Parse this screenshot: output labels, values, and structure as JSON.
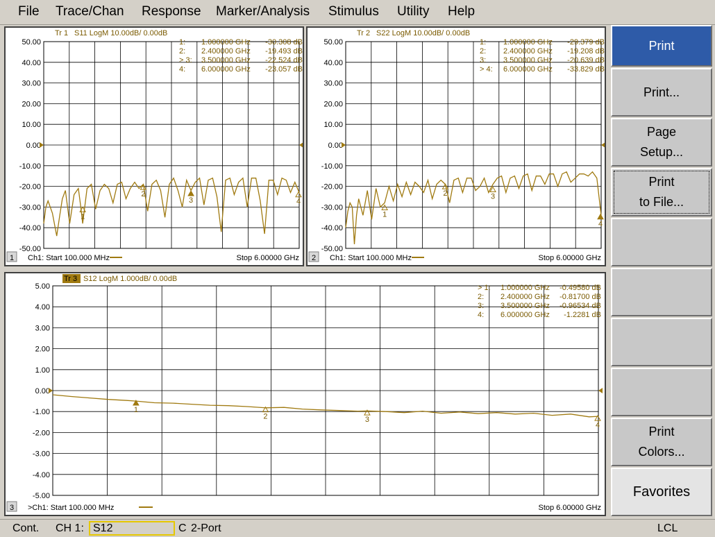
{
  "menu": [
    "File",
    "Trace/Chan",
    "Response",
    "Marker/Analysis",
    "Stimulus",
    "Utility",
    "Help"
  ],
  "softkeys": [
    {
      "lines": [
        "Print"
      ],
      "active": true
    },
    {
      "lines": [
        "Print..."
      ]
    },
    {
      "lines": [
        "Page",
        "Setup..."
      ]
    },
    {
      "lines": [
        "Print",
        "to File..."
      ],
      "focused": true
    },
    {
      "lines": [
        ""
      ]
    },
    {
      "lines": [
        ""
      ]
    },
    {
      "lines": [
        ""
      ]
    },
    {
      "lines": [
        ""
      ]
    },
    {
      "lines": [
        "Print",
        "Colors..."
      ]
    },
    {
      "lines": [
        "Favorites"
      ],
      "favorites": true
    }
  ],
  "status": {
    "mode": "Cont.",
    "channel": "CH 1:",
    "parameter": "S12",
    "cal": "C",
    "port": "2-Port",
    "remote": "LCL"
  },
  "colors": {
    "trace": "#a07a10",
    "grid": "#000000",
    "text": "#7a5a00",
    "active_bg": "#2e5ba8"
  },
  "chart_data": [
    {
      "type": "line",
      "window_number": "1",
      "trace_id": "Tr 1",
      "title": "S11 LogM 10.00dB/ 0.00dB",
      "ylim": [
        -50,
        50
      ],
      "yticks": [
        50,
        40,
        30,
        20,
        10,
        0,
        -10,
        -20,
        -30,
        -40,
        -50
      ],
      "ytick_labels": [
        "50.00",
        "40.00",
        "30.00",
        "20.00",
        "10.00",
        "0.00",
        "-10.00",
        "-20.00",
        "-30.00",
        "-40.00",
        "-50.00"
      ],
      "xlim": [
        0.1,
        6.0
      ],
      "start_label": "Ch1: Start  100.000 MHz",
      "stop_label": "Stop  6.00000 GHz",
      "reference_level": 0,
      "markers": [
        {
          "id": "1",
          "active": false,
          "freq": "1.000000 GHz",
          "value": "-30.308 dB",
          "x": 1.0,
          "y": -30.308
        },
        {
          "id": "2",
          "active": false,
          "freq": "2.400000 GHz",
          "value": "-19.493 dB",
          "x": 2.4,
          "y": -19.493
        },
        {
          "id": "3",
          "active": true,
          "freq": "3.500000 GHz",
          "value": "-22.524 dB",
          "x": 3.5,
          "y": -22.524
        },
        {
          "id": "4",
          "active": false,
          "freq": "6.000000 GHz",
          "value": "-23.057 dB",
          "x": 6.0,
          "y": -23.057
        }
      ],
      "series": [
        {
          "x": [
            0.1,
            0.15,
            0.2,
            0.3,
            0.4,
            0.47,
            0.53,
            0.6,
            0.7,
            0.8,
            0.9,
            0.95,
            1.0,
            1.1,
            1.2,
            1.3,
            1.4,
            1.5,
            1.6,
            1.7,
            1.8,
            1.9,
            2.0,
            2.1,
            2.2,
            2.3,
            2.4,
            2.5,
            2.6,
            2.7,
            2.8,
            2.9,
            3.0,
            3.1,
            3.2,
            3.3,
            3.4,
            3.5,
            3.6,
            3.7,
            3.8,
            3.9,
            4.0,
            4.1,
            4.2,
            4.3,
            4.4,
            4.5,
            4.6,
            4.7,
            4.8,
            4.9,
            5.0,
            5.1,
            5.2,
            5.3,
            5.4,
            5.5,
            5.6,
            5.7,
            5.8,
            5.9,
            6.0
          ],
          "y": [
            -38,
            -30,
            -27,
            -33,
            -44,
            -34,
            -26,
            -22,
            -38,
            -24,
            -21,
            -29,
            -38,
            -21,
            -19,
            -31,
            -22,
            -19,
            -21,
            -28,
            -19,
            -18,
            -26,
            -21,
            -18,
            -21,
            -19,
            -32,
            -19,
            -17,
            -22,
            -35,
            -19,
            -16,
            -22,
            -30,
            -17,
            -22,
            -18,
            -16,
            -29,
            -17,
            -16,
            -25,
            -42,
            -17,
            -16,
            -24,
            -18,
            -16,
            -30,
            -16,
            -16,
            -27,
            -43,
            -17,
            -17,
            -24,
            -16,
            -17,
            -23,
            -18,
            -23
          ]
        }
      ]
    },
    {
      "type": "line",
      "window_number": "2",
      "trace_id": "Tr 2",
      "title": "S22 LogM 10.00dB/ 0.00dB",
      "ylim": [
        -50,
        50
      ],
      "yticks": [
        50,
        40,
        30,
        20,
        10,
        0,
        -10,
        -20,
        -30,
        -40,
        -50
      ],
      "ytick_labels": [
        "50.00",
        "40.00",
        "30.00",
        "20.00",
        "10.00",
        "0.00",
        "-10.00",
        "-20.00",
        "-30.00",
        "-40.00",
        "-50.00"
      ],
      "xlim": [
        0.1,
        6.0
      ],
      "start_label": "Ch1: Start  100.000 MHz",
      "stop_label": "Stop  6.00000 GHz",
      "reference_level": 0,
      "markers": [
        {
          "id": "1",
          "active": false,
          "freq": "1.000000 GHz",
          "value": "-29.379 dB",
          "x": 1.0,
          "y": -29.379
        },
        {
          "id": "2",
          "active": false,
          "freq": "2.400000 GHz",
          "value": "-19.208 dB",
          "x": 2.4,
          "y": -19.208
        },
        {
          "id": "3",
          "active": false,
          "freq": "3.500000 GHz",
          "value": "-20.639 dB",
          "x": 3.5,
          "y": -20.639
        },
        {
          "id": "4",
          "active": true,
          "freq": "6.000000 GHz",
          "value": "-33.829 dB",
          "x": 6.0,
          "y": -33.829
        }
      ],
      "series": [
        {
          "x": [
            0.1,
            0.15,
            0.2,
            0.25,
            0.3,
            0.35,
            0.4,
            0.5,
            0.6,
            0.7,
            0.8,
            0.9,
            1.0,
            1.1,
            1.2,
            1.3,
            1.4,
            1.5,
            1.6,
            1.7,
            1.8,
            1.9,
            2.0,
            2.1,
            2.2,
            2.3,
            2.4,
            2.5,
            2.6,
            2.7,
            2.8,
            2.9,
            3.0,
            3.1,
            3.2,
            3.3,
            3.4,
            3.5,
            3.6,
            3.7,
            3.8,
            3.9,
            4.0,
            4.1,
            4.2,
            4.3,
            4.4,
            4.5,
            4.6,
            4.7,
            4.8,
            4.9,
            5.0,
            5.1,
            5.2,
            5.3,
            5.4,
            5.5,
            5.6,
            5.7,
            5.8,
            5.9,
            6.0
          ],
          "y": [
            -40,
            -32,
            -28,
            -30,
            -48,
            -34,
            -26,
            -34,
            -22,
            -36,
            -21,
            -30,
            -28,
            -20,
            -27,
            -19,
            -25,
            -18,
            -24,
            -18,
            -20,
            -23,
            -17,
            -26,
            -19,
            -17,
            -19,
            -28,
            -17,
            -16,
            -23,
            -16,
            -16,
            -22,
            -20,
            -16,
            -23,
            -19,
            -16,
            -15,
            -23,
            -16,
            -15,
            -21,
            -15,
            -14,
            -22,
            -15,
            -15,
            -19,
            -14,
            -14,
            -20,
            -14,
            -13,
            -18,
            -16,
            -14,
            -14,
            -15,
            -13,
            -16,
            -34
          ]
        }
      ]
    },
    {
      "type": "line",
      "window_number": "3",
      "trace_id": "Tr 3",
      "title": "S12 LogM 1.000dB/ 0.00dB",
      "ylim": [
        -5,
        5
      ],
      "yticks": [
        5,
        4,
        3,
        2,
        1,
        0,
        -1,
        -2,
        -3,
        -4,
        -5
      ],
      "ytick_labels": [
        "5.00",
        "4.00",
        "3.00",
        "2.00",
        "1.00",
        "0.00",
        "-1.00",
        "-2.00",
        "-3.00",
        "-4.00",
        "-5.00"
      ],
      "xlim": [
        0.1,
        6.0
      ],
      "start_label": ">Ch1: Start  100.000 MHz",
      "stop_label": "Stop  6.00000 GHz",
      "reference_level": 0,
      "markers": [
        {
          "id": "1",
          "active": true,
          "freq": "1.000000 GHz",
          "value": "-0.49580 dB",
          "x": 1.0,
          "y": -0.4958
        },
        {
          "id": "2",
          "active": false,
          "freq": "2.400000 GHz",
          "value": "-0.81700 dB",
          "x": 2.4,
          "y": -0.817
        },
        {
          "id": "3",
          "active": false,
          "freq": "3.500000 GHz",
          "value": "-0.96534 dB",
          "x": 3.5,
          "y": -0.96534
        },
        {
          "id": "4",
          "active": false,
          "freq": "6.000000 GHz",
          "value": "-1.2281 dB",
          "x": 6.0,
          "y": -1.2281
        }
      ],
      "series": [
        {
          "x": [
            0.1,
            0.3,
            0.5,
            0.7,
            0.9,
            1.0,
            1.2,
            1.4,
            1.6,
            1.8,
            2.0,
            2.2,
            2.4,
            2.6,
            2.8,
            3.0,
            3.2,
            3.4,
            3.5,
            3.7,
            3.9,
            4.1,
            4.3,
            4.5,
            4.7,
            4.9,
            5.1,
            5.3,
            5.5,
            5.7,
            5.9,
            6.0
          ],
          "y": [
            -0.2,
            -0.28,
            -0.35,
            -0.42,
            -0.47,
            -0.5,
            -0.58,
            -0.6,
            -0.65,
            -0.7,
            -0.72,
            -0.76,
            -0.82,
            -0.8,
            -0.88,
            -0.92,
            -0.95,
            -0.98,
            -0.97,
            -1.0,
            -1.05,
            -0.98,
            -1.08,
            -1.02,
            -1.1,
            -1.05,
            -1.12,
            -1.08,
            -1.18,
            -1.12,
            -1.25,
            -1.23
          ]
        }
      ]
    }
  ]
}
